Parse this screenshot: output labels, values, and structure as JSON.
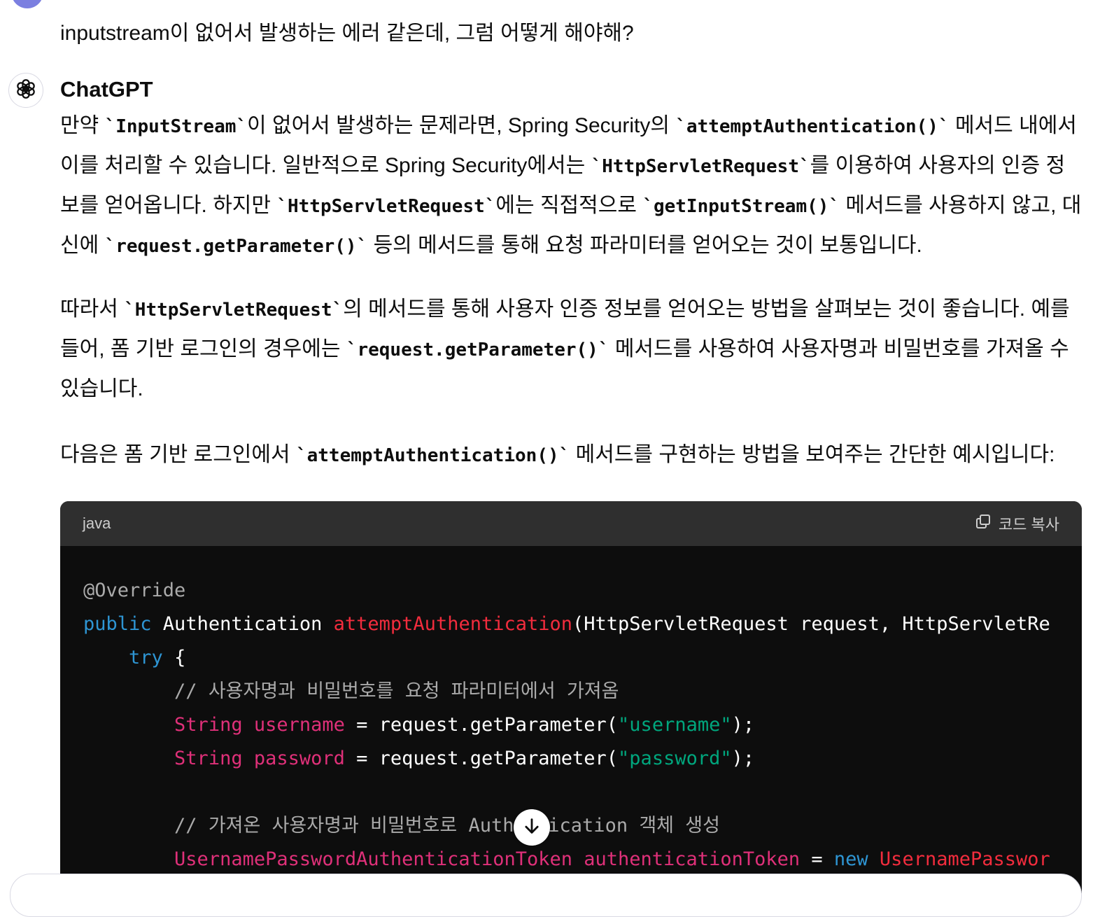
{
  "user_message": {
    "text": "inputstream이 없어서 발생하는 에러 같은데, 그럼 어떻게 해야해?"
  },
  "assistant": {
    "name": "ChatGPT",
    "paragraphs": [
      [
        "만약 ",
        "`InputStream`",
        "이 없어서 발생하는 문제라면, Spring Security의 ",
        "`attemptAuthentication()`",
        " 메서드 내에서 이를 처리할 수 있습니다. 일반적으로 Spring Security에서는 ",
        "`HttpServletRequest`",
        "를 이용하여 사용자의 인증 정보를 얻어옵니다. 하지만 ",
        "`HttpServletRequest`",
        "에는 직접적으로 ",
        "`getInputStream()`",
        " 메서드를 사용하지 않고, 대신에 ",
        "`request.getParameter()`",
        " 등의 메서드를 통해 요청 파라미터를 얻어오는 것이 보통입니다."
      ],
      [
        "따라서 ",
        "`HttpServletRequest`",
        "의 메서드를 통해 사용자 인증 정보를 얻어오는 방법을 살펴보는 것이 좋습니다. 예를 들어, 폼 기반 로그인의 경우에는 ",
        "`request.getParameter()`",
        " 메서드를 사용하여 사용자명과 비밀번호를 가져올 수 있습니다."
      ],
      [
        "다음은 폼 기반 로그인에서 ",
        "`attemptAuthentication()`",
        " 메서드를 구현하는 방법을 보여주는 간단한 예시입니다:"
      ]
    ]
  },
  "code_block": {
    "language": "java",
    "copy_label": "코드 복사",
    "lines": {
      "l1": "@Override",
      "l2_kw": "public",
      "l2_type": " Authentication ",
      "l2_fn": "attemptAuthentication",
      "l2_rest": "(HttpServletRequest request, HttpServletRe",
      "l3_kw": "try",
      "l3_rest": " {",
      "l4_comment": "// 사용자명과 비밀번호를 요청 파라미터에서 가져옴",
      "l5_type": "String",
      "l5_var": " username",
      "l5_mid": " = request.getParameter(",
      "l5_str": "\"username\"",
      "l5_end": ");",
      "l6_type": "String",
      "l6_var": " password",
      "l6_mid": " = request.getParameter(",
      "l6_str": "\"password\"",
      "l6_end": ");",
      "l8_comment": "// 가져온 사용자명과 비밀번호로 Authentication 객체 생성",
      "l9_type": "UsernamePasswordAuthenticationToken",
      "l9_var": " authenticationToken",
      "l9_mid": " = ",
      "l9_kw": "new",
      "l9_fn": " UsernamePasswor"
    }
  },
  "icons": {
    "gpt_logo": "openai-logo-icon",
    "copy": "copy-icon",
    "scroll": "arrow-down-icon"
  },
  "colors": {
    "keyword": "#2e95d3",
    "function": "#f22c3d",
    "type": "#df3079",
    "string": "#00a67d",
    "comment": "#aaaaaa",
    "code_bg": "#0d0d0d",
    "code_header_bg": "#2f2f2f"
  }
}
